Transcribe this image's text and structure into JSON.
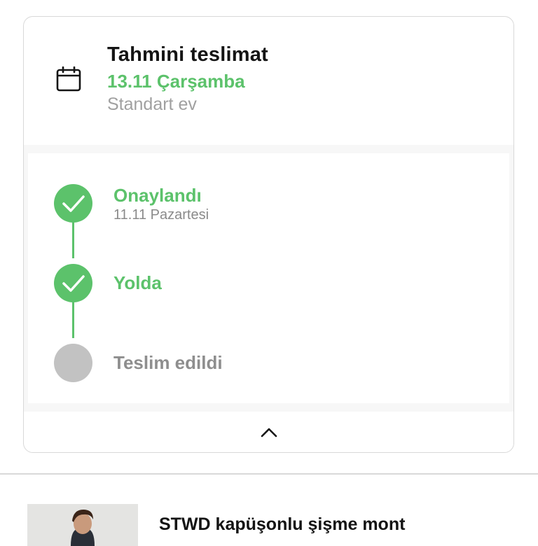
{
  "delivery": {
    "title": "Tahmini teslimat",
    "date": "13.11 Çarşamba",
    "type": "Standart ev"
  },
  "timeline": {
    "steps": [
      {
        "label": "Onaylandı",
        "sub": "11.11 Pazartesi",
        "status": "done"
      },
      {
        "label": "Yolda",
        "status": "done"
      },
      {
        "label": "Teslim edildi",
        "status": "pending"
      }
    ]
  },
  "icons": {
    "calendar": "calendar-icon",
    "check": "checkmark-icon",
    "collapse": "chevron-up-icon"
  },
  "colors": {
    "accent_green": "#5cc26b",
    "pending_gray": "#c2c2c2",
    "text_dark": "#141414",
    "text_muted": "#a0a0a0"
  },
  "product": {
    "name": "STWD kapüşonlu şişme mont"
  }
}
